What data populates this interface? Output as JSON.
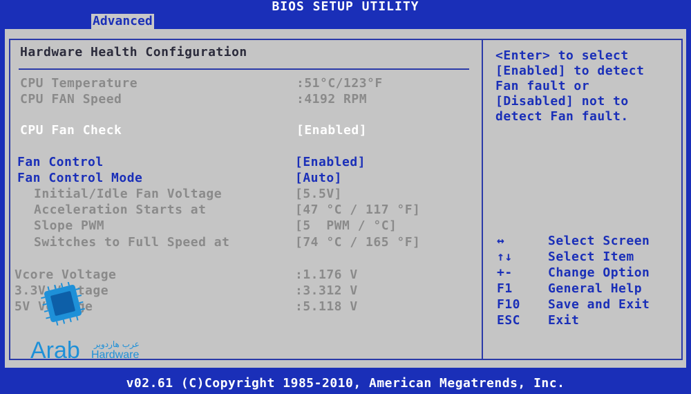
{
  "header": {
    "title": "BIOS SETUP UTILITY",
    "active_tab": "Advanced"
  },
  "main": {
    "section_title": "Hardware Health Configuration",
    "monitor": [
      {
        "label": "CPU Temperature",
        "value": ":51°C/123°F"
      },
      {
        "label": "CPU FAN Speed",
        "value": ":4192 RPM"
      }
    ],
    "fan_check": {
      "label": "CPU Fan Check",
      "value": "[Enabled]"
    },
    "fan_control": {
      "label": "Fan Control",
      "value": "[Enabled]"
    },
    "fan_control_mode": {
      "label": "Fan Control Mode",
      "value": "[Auto]"
    },
    "sub_settings": [
      {
        "label": "Initial/Idle Fan Voltage",
        "value": "[5.5V]"
      },
      {
        "label": "Acceleration Starts at",
        "value": "[47 °C / 117 °F]"
      },
      {
        "label": "Slope PWM",
        "value": "[5  PWM / °C]"
      },
      {
        "label": "Switches to Full Speed at",
        "value": "[74 °C / 165 °F]"
      }
    ],
    "voltages": [
      {
        "label": "Vcore Voltage",
        "value": ":1.176 V"
      },
      {
        "label": "3.3V Voltage",
        "value": ":3.312 V"
      },
      {
        "label": "5V Voltage",
        "value": ":5.118 V"
      }
    ]
  },
  "help": {
    "lines": [
      "<Enter> to select",
      "[Enabled] to detect",
      "Fan fault or",
      "[Disabled] not to",
      "detect Fan fault."
    ],
    "keys": [
      {
        "key": "↔",
        "action": "Select Screen"
      },
      {
        "key": "↑↓",
        "action": "Select Item"
      },
      {
        "key": "+-",
        "action": "Change Option"
      },
      {
        "key": "F1",
        "action": "General Help"
      },
      {
        "key": "F10",
        "action": "Save and Exit"
      },
      {
        "key": "ESC",
        "action": "Exit"
      }
    ]
  },
  "logo": {
    "text": "Arab",
    "text2": "Hardware",
    "arabic": "عرب هاردوير"
  },
  "footer": {
    "text": "v02.61 (C)Copyright 1985-2010, American Megatrends, Inc."
  },
  "colors": {
    "bios_blue": "#1a2fb8",
    "panel_gray": "#c5c5c5",
    "logo_cyan": "#1e90d8"
  }
}
